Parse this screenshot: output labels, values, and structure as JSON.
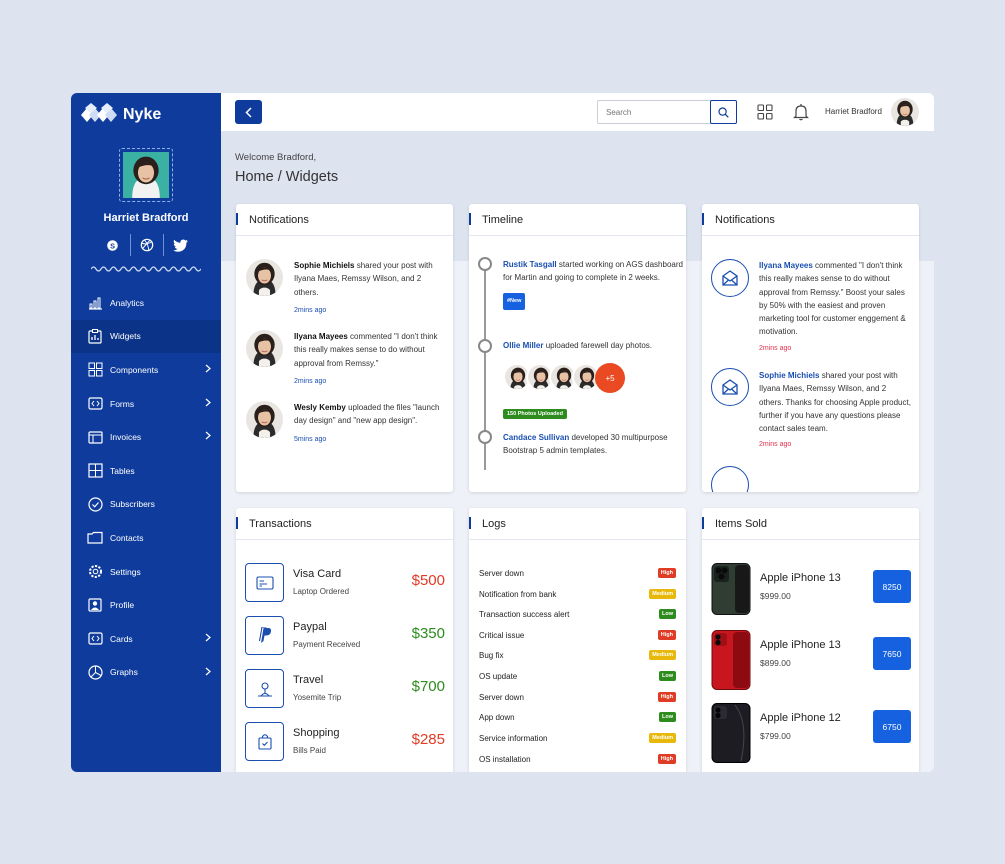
{
  "brand": {
    "name": "Nyke"
  },
  "profile": {
    "name": "Harriet Bradford"
  },
  "socials": [
    "skype-icon",
    "dribbble-icon",
    "twitter-icon"
  ],
  "nav": [
    {
      "label": "Analytics",
      "icon": "analytics-icon",
      "chevron": false
    },
    {
      "label": "Widgets",
      "icon": "widgets-icon",
      "chevron": false,
      "active": true
    },
    {
      "label": "Components",
      "icon": "components-icon",
      "chevron": true
    },
    {
      "label": "Forms",
      "icon": "forms-icon",
      "chevron": true
    },
    {
      "label": "Invoices",
      "icon": "invoices-icon",
      "chevron": true
    },
    {
      "label": "Tables",
      "icon": "tables-icon",
      "chevron": false
    },
    {
      "label": "Subscribers",
      "icon": "subscribers-icon",
      "chevron": false
    },
    {
      "label": "Contacts",
      "icon": "contacts-icon",
      "chevron": false
    },
    {
      "label": "Settings",
      "icon": "settings-icon",
      "chevron": false
    },
    {
      "label": "Profile",
      "icon": "profile-icon",
      "chevron": false
    },
    {
      "label": "Cards",
      "icon": "cards-icon",
      "chevron": true
    },
    {
      "label": "Graphs",
      "icon": "graphs-icon",
      "chevron": true
    }
  ],
  "topbar": {
    "search_placeholder": "Search",
    "user_name": "Harriet Bradford"
  },
  "page": {
    "welcome": "Welcome Bradford,",
    "breadcrumb": "Home / Widgets"
  },
  "notifications": {
    "title": "Notifications",
    "items": [
      {
        "name": "Sophie Michiels",
        "text": " shared your post with Ilyana Maes, Remssy Wilson, and 2 others.",
        "time": "2mins ago"
      },
      {
        "name": "Ilyana Mayees",
        "text": " commented \"I don't think this really makes sense to do without approval from Remssy.\"",
        "time": "2mins ago"
      },
      {
        "name": "Wesly Kemby",
        "text": " uploaded the files \"launch day design\" and \"new app design\".",
        "time": "5mins ago"
      }
    ]
  },
  "timeline": {
    "title": "Timeline",
    "items": [
      {
        "name": "Rustik Tasgall",
        "text": " started working on AGS dashboard for Martin and going to complete in 2 weeks.",
        "badge": "#New"
      },
      {
        "name": "Ollie Miller",
        "text": " uploaded farewell day photos.",
        "extra": "+5",
        "badge": "150 Photos Uploaded"
      },
      {
        "name": "Candace Sullivan",
        "text": " developed 30 multipurpose Bootstrap 5 admin templates."
      }
    ]
  },
  "notifications2": {
    "title": "Notifications",
    "items": [
      {
        "name": "Ilyana Mayees",
        "text": " commented \"I don't think this really makes sense to do without approval from Remssy.\" Boost your sales by 50% with the easiest and proven marketing tool for customer enggement & motivation.",
        "time": "2mins ago"
      },
      {
        "name": "Sophie Michiels",
        "text": " shared your post with Ilyana Maes, Remssy Wilson, and 2 others. Thanks for choosing Apple product, further if you have any questions please contact sales team.",
        "time": "2mins ago"
      }
    ]
  },
  "transactions": {
    "title": "Transactions",
    "items": [
      {
        "name": "Visa Card",
        "sub": "Laptop Ordered",
        "amount": "$500",
        "color": "#e03b24",
        "icon": "credit-card-icon"
      },
      {
        "name": "Paypal",
        "sub": "Payment Received",
        "amount": "$350",
        "color": "#2e8b1e",
        "icon": "paypal-icon"
      },
      {
        "name": "Travel",
        "sub": "Yosemite Trip",
        "amount": "$700",
        "color": "#2e8b1e",
        "icon": "travel-icon"
      },
      {
        "name": "Shopping",
        "sub": "Bills Paid",
        "amount": "$285",
        "color": "#e03b24",
        "icon": "shopping-bag-icon"
      }
    ]
  },
  "logs": {
    "title": "Logs",
    "items": [
      {
        "label": "Server down",
        "level": "High"
      },
      {
        "label": "Notification from bank",
        "level": "Medium"
      },
      {
        "label": "Transaction success alert",
        "level": "Low"
      },
      {
        "label": "Critical issue",
        "level": "High"
      },
      {
        "label": "Bug fix",
        "level": "Medium"
      },
      {
        "label": "OS update",
        "level": "Low"
      },
      {
        "label": "Server down",
        "level": "High"
      },
      {
        "label": "App down",
        "level": "Low"
      },
      {
        "label": "Service information",
        "level": "Medium"
      },
      {
        "label": "OS installation",
        "level": "High"
      }
    ],
    "level_colors": {
      "High": "#e03b24",
      "Medium": "#e8b90c",
      "Low": "#2e8b1e"
    }
  },
  "items_sold": {
    "title": "Items Sold",
    "items": [
      {
        "name": "Apple iPhone 13",
        "price": "$999.00",
        "count": "8250",
        "phone_color": "#2f3d33"
      },
      {
        "name": "Apple iPhone 13",
        "price": "$899.00",
        "count": "7650",
        "phone_color": "#c8161e"
      },
      {
        "name": "Apple iPhone 12",
        "price": "$799.00",
        "count": "6750",
        "phone_color": "#1c1c22"
      }
    ]
  },
  "colors": {
    "sidebar": "#0f3c9c",
    "accent": "#1661e0",
    "link": "#1a4fb0"
  }
}
